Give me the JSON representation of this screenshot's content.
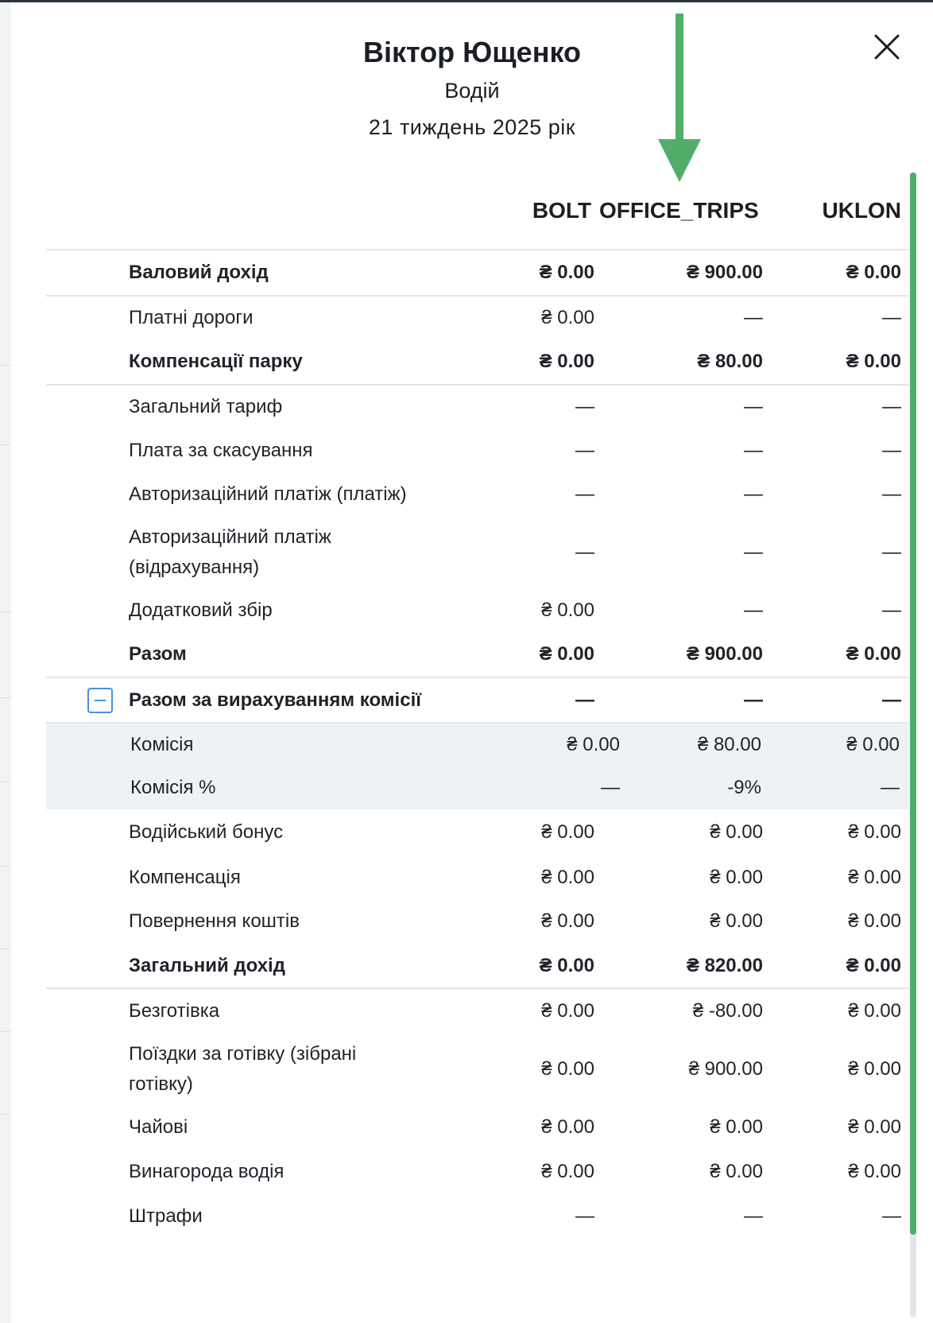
{
  "header": {
    "title": "Віктор Ющенко",
    "subtitle": "Водій",
    "period": "21 тиждень 2025 рік"
  },
  "columns": [
    "BOLT",
    "OFFICE_TRIPS",
    "UKLON"
  ],
  "rows": [
    {
      "label": "Валовий дохід",
      "values": [
        "₴ 0.00",
        "₴ 900.00",
        "₴ 0.00"
      ],
      "bold": true
    },
    {
      "label": "Платні дороги",
      "values": [
        "₴ 0.00",
        "—",
        "—"
      ],
      "bold": false
    },
    {
      "label": "Компенсації парку",
      "values": [
        "₴ 0.00",
        "₴ 80.00",
        "₴ 0.00"
      ],
      "bold": true
    },
    {
      "label": "Загальний тариф",
      "values": [
        "—",
        "—",
        "—"
      ],
      "bold": false
    },
    {
      "label": "Плата за скасування",
      "values": [
        "—",
        "—",
        "—"
      ],
      "bold": false
    },
    {
      "label": "Авторизаційний платіж (платіж)",
      "values": [
        "—",
        "—",
        "—"
      ],
      "bold": false
    },
    {
      "label": "Авторизаційний платіж (відрахування)",
      "values": [
        "—",
        "—",
        "—"
      ],
      "bold": false
    },
    {
      "label": "Додатковий збір",
      "values": [
        "₴ 0.00",
        "—",
        "—"
      ],
      "bold": false
    },
    {
      "label": "Разом",
      "values": [
        "₴ 0.00",
        "₴ 900.00",
        "₴ 0.00"
      ],
      "bold": true
    },
    {
      "label": "Разом за вирахуванням комісії",
      "values": [
        "—",
        "—",
        "—"
      ],
      "bold": true
    },
    {
      "label": "Комісія",
      "values": [
        "₴ 0.00",
        "₴ 80.00",
        "₴ 0.00"
      ],
      "bold": false
    },
    {
      "label": "Комісія %",
      "values": [
        "—",
        "-9%",
        "—"
      ],
      "bold": false
    },
    {
      "label": "Водійський бонус",
      "values": [
        "₴ 0.00",
        "₴ 0.00",
        "₴ 0.00"
      ],
      "bold": false
    },
    {
      "label": "Компенсація",
      "values": [
        "₴ 0.00",
        "₴ 0.00",
        "₴ 0.00"
      ],
      "bold": false
    },
    {
      "label": "Повернення коштів",
      "values": [
        "₴ 0.00",
        "₴ 0.00",
        "₴ 0.00"
      ],
      "bold": false
    },
    {
      "label": "Загальний дохід",
      "values": [
        "₴ 0.00",
        "₴ 820.00",
        "₴ 0.00"
      ],
      "bold": true
    },
    {
      "label": "Безготівка",
      "values": [
        "₴ 0.00",
        "₴ -80.00",
        "₴ 0.00"
      ],
      "bold": false
    },
    {
      "label": "Поїздки за готівку (зібрані готівку)",
      "values": [
        "₴ 0.00",
        "₴ 900.00",
        "₴ 0.00"
      ],
      "bold": false
    },
    {
      "label": "Чайові",
      "values": [
        "₴ 0.00",
        "₴ 0.00",
        "₴ 0.00"
      ],
      "bold": false
    },
    {
      "label": "Винагорода водія",
      "values": [
        "₴ 0.00",
        "₴ 0.00",
        "₴ 0.00"
      ],
      "bold": false
    },
    {
      "label": "Штрафи",
      "values": [
        "—",
        "—",
        "—"
      ],
      "bold": false
    }
  ],
  "colors": {
    "scroll_thumb": "#52ad6b",
    "annotation_arrow": "#52ad6b",
    "subrow_bg": "#eef2f7",
    "collapse_icon": "#4a8fe0"
  },
  "icons": {
    "close": "close-icon",
    "collapse": "minus-square-icon",
    "annotation": "arrow-down-icon"
  }
}
